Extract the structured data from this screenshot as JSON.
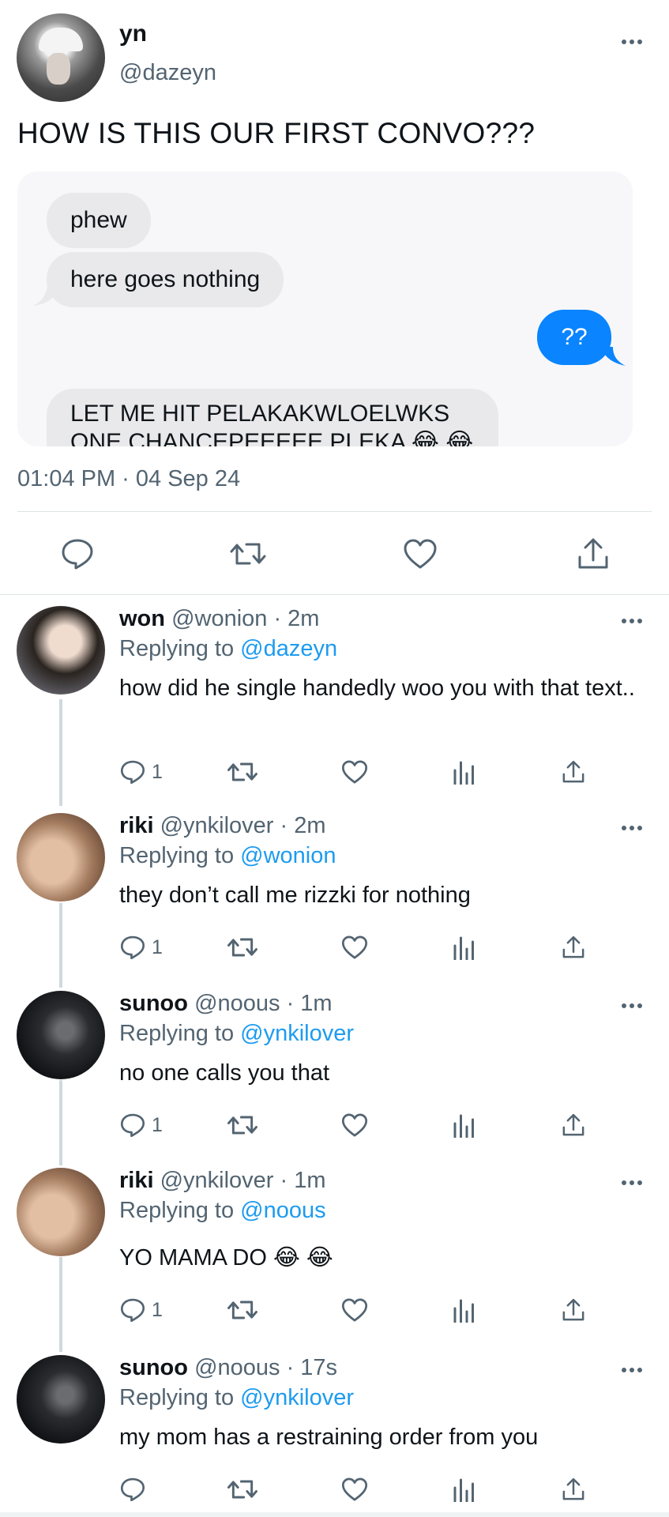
{
  "tweet": {
    "author_name": "yn",
    "author_handle": "@dazeyn",
    "text": "HOW IS THIS OUR FIRST CONVO???",
    "timestamp": "01:04 PM · 04 Sep 24",
    "chat": {
      "msg1": "phew",
      "msg2": "here goes nothing",
      "msg3": "??",
      "msg4_line1": "LET ME HIT PELAKAKWLOELWKS",
      "msg4_line2": "ONE CHANCEPEEEEE PLEKA 😂 😂"
    }
  },
  "replies": [
    {
      "name": "won",
      "meta": "@wonion · 2m",
      "replying_label": "Replying to",
      "replying_to": "@dazeyn",
      "text": "how did he single handedly woo you with that text..",
      "reply_count": "1"
    },
    {
      "name": "riki",
      "meta": "@ynkilover · 2m",
      "replying_label": "Replying to",
      "replying_to": "@wonion",
      "text": "they don’t call me rizzki for nothing",
      "reply_count": "1"
    },
    {
      "name": "sunoo",
      "meta": "@noous · 1m",
      "replying_label": "Replying to",
      "replying_to": "@ynkilover",
      "text": "no one calls you that",
      "reply_count": "1"
    },
    {
      "name": "riki",
      "meta": "@ynkilover · 1m",
      "replying_label": "Replying to",
      "replying_to": "@noous",
      "text": "YO MAMA DO 😂 😂",
      "reply_count": "1"
    },
    {
      "name": "sunoo",
      "meta": "@noous · 17s",
      "replying_label": "Replying to",
      "replying_to": "@ynkilover",
      "text": "my mom has a restraining order from you",
      "reply_count": ""
    }
  ],
  "colors": {
    "accent": "#1d9bf0",
    "imessage_blue": "#0a84ff",
    "muted": "#536471"
  }
}
